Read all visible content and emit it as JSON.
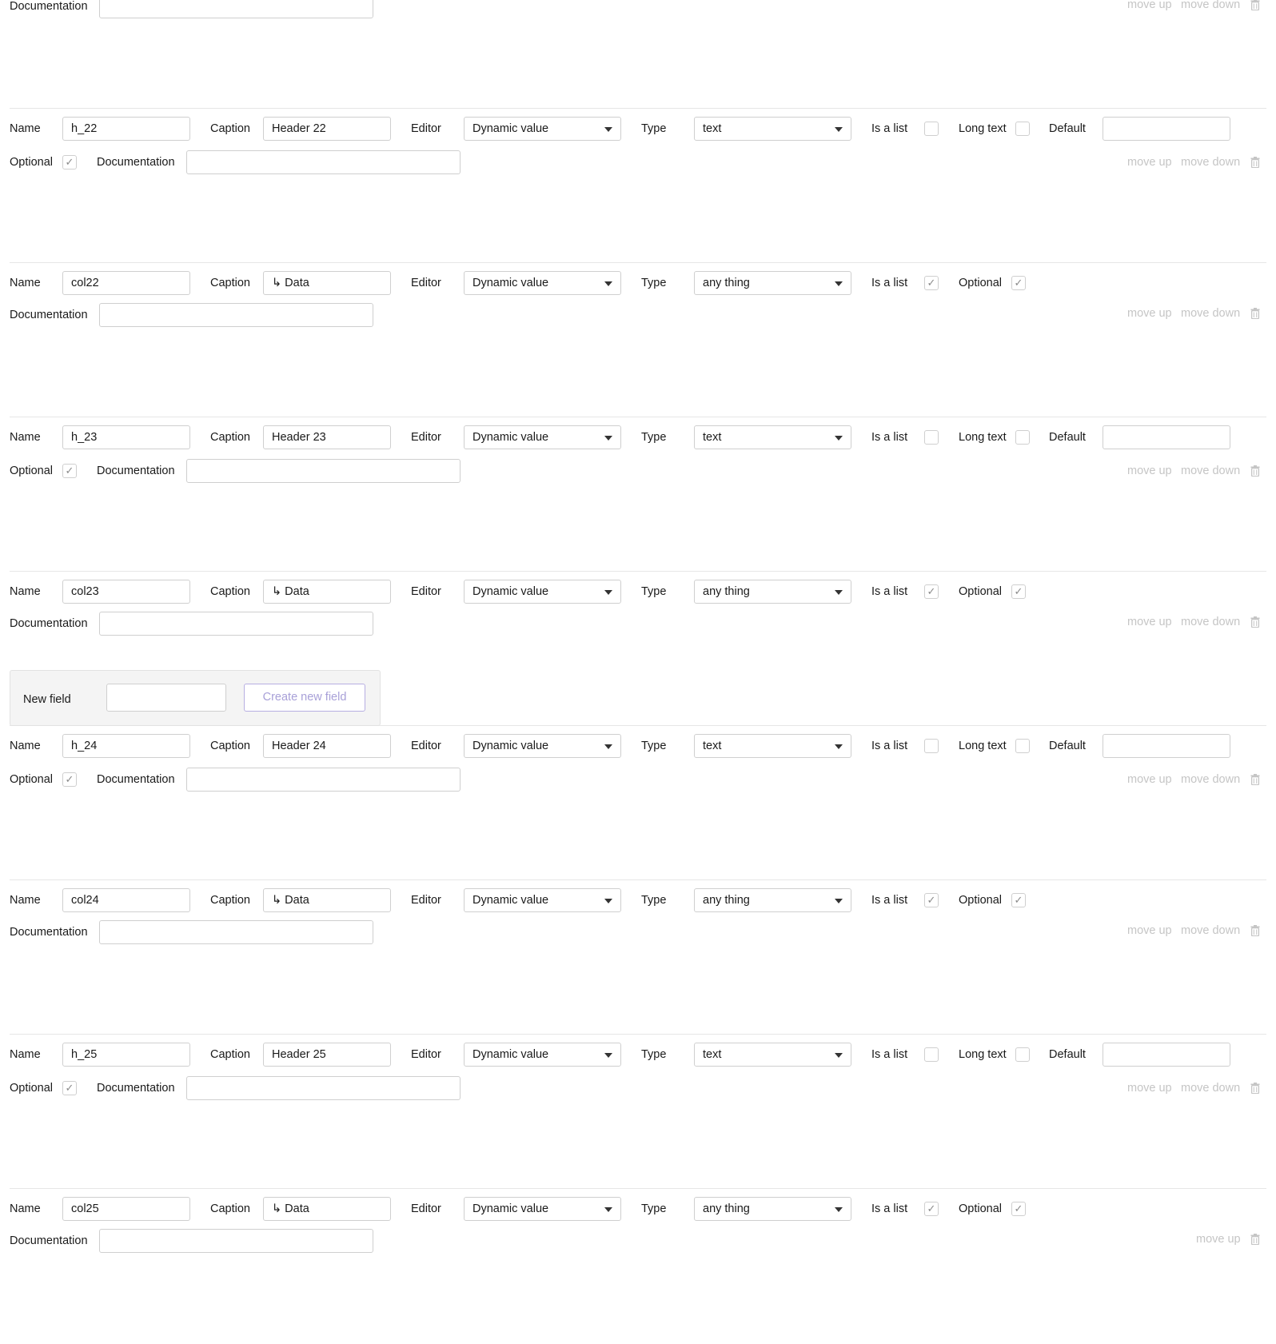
{
  "labels": {
    "name": "Name",
    "caption": "Caption",
    "editor": "Editor",
    "type": "Type",
    "is_list": "Is a list",
    "long_text": "Long text",
    "default": "Default",
    "optional": "Optional",
    "documentation": "Documentation",
    "move_up": "move up",
    "move_down": "move down"
  },
  "fields": [
    {
      "name": "",
      "caption": "",
      "editor": "",
      "type": "",
      "kind": "partial",
      "is_list": false,
      "long_text": false,
      "optional": true,
      "move_down": true
    },
    {
      "name": "h_22",
      "caption": "Header 22",
      "editor": "Dynamic value",
      "type": "text",
      "kind": "header",
      "is_list": false,
      "long_text": false,
      "default": "",
      "optional": true,
      "move_down": true
    },
    {
      "name": "col22",
      "caption": "↳ Data",
      "editor": "Dynamic value",
      "type": "any thing",
      "kind": "data",
      "is_list": true,
      "optional": true,
      "move_down": true
    },
    {
      "name": "h_23",
      "caption": "Header 23",
      "editor": "Dynamic value",
      "type": "text",
      "kind": "header",
      "is_list": false,
      "long_text": false,
      "default": "",
      "optional": true,
      "move_down": true
    },
    {
      "name": "col23",
      "caption": "↳ Data",
      "editor": "Dynamic value",
      "type": "any thing",
      "kind": "data",
      "is_list": true,
      "optional": true,
      "move_down": true
    },
    {
      "name": "h_24",
      "caption": "Header 24",
      "editor": "Dynamic value",
      "type": "text",
      "kind": "header",
      "is_list": false,
      "long_text": false,
      "default": "",
      "optional": true,
      "move_down": true
    },
    {
      "name": "col24",
      "caption": "↳ Data",
      "editor": "Dynamic value",
      "type": "any thing",
      "kind": "data",
      "is_list": true,
      "optional": true,
      "move_down": true
    },
    {
      "name": "h_25",
      "caption": "Header 25",
      "editor": "Dynamic value",
      "type": "text",
      "kind": "header",
      "is_list": false,
      "long_text": false,
      "default": "",
      "optional": true,
      "move_down": true
    },
    {
      "name": "col25",
      "caption": "↳ Data",
      "editor": "Dynamic value",
      "type": "any thing",
      "kind": "data",
      "is_list": true,
      "optional": true,
      "move_down": false
    }
  ],
  "new_field": {
    "label": "New field",
    "value": "",
    "button": "Create new field",
    "button_color": "#a8a0d8"
  },
  "icons": {
    "trash": "trash-icon",
    "dropdown": "chevron-down-icon",
    "check": "checkmark-icon"
  }
}
